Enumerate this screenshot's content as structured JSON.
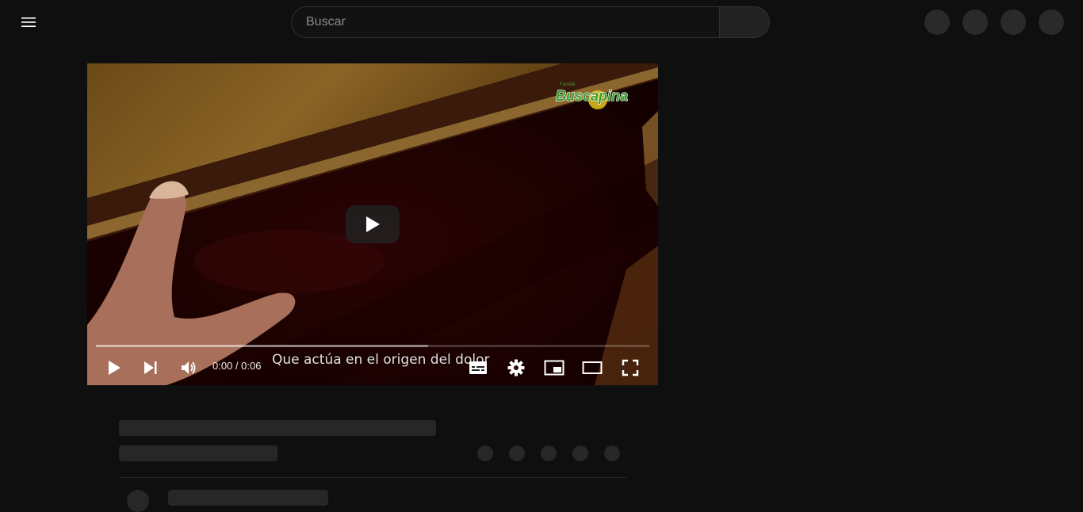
{
  "search": {
    "placeholder": "Buscar"
  },
  "player": {
    "time_current": "0:00",
    "time_separator": " / ",
    "time_total": "0:06",
    "caption": "Que actúa en el origen del dolor",
    "buffered_fraction": 0.6
  },
  "brand": {
    "line1": "Familia",
    "line2": "Buscapina"
  },
  "icons": {
    "menu": "hamburger-menu-icon",
    "play": "play-icon",
    "next": "skip-next-icon",
    "volume": "volume-icon",
    "subtitles": "subtitles-icon",
    "settings": "gear-icon",
    "miniplayer": "miniplayer-icon",
    "theater": "theater-mode-icon",
    "fullscreen": "fullscreen-icon"
  },
  "colors": {
    "background": "#0f0f0f",
    "skeleton": "#272727",
    "brand_green": "#3a9d2e"
  }
}
